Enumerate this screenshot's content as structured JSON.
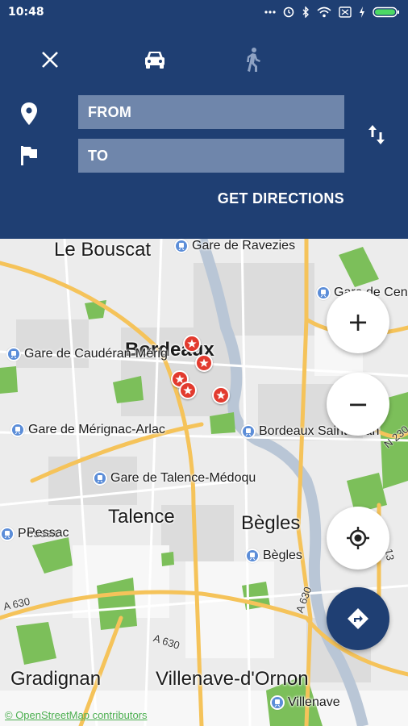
{
  "status_bar": {
    "time": "10:48",
    "icons": [
      "more-dots-icon",
      "alarm-icon",
      "bluetooth-icon",
      "wifi-icon",
      "sim-off-icon",
      "charging-icon",
      "battery-icon"
    ]
  },
  "header": {
    "modes": [
      "close-icon",
      "car-icon",
      "walk-icon"
    ],
    "from_label": "FROM",
    "to_label": "TO",
    "get_directions": "GET DIRECTIONS",
    "swap_icon": "swap-vertical-icon"
  },
  "map": {
    "places": {
      "le_bouscat": "Le Bouscat",
      "bordeaux": "Bordeaux",
      "talence": "Talence",
      "begles": "Bègles",
      "gradignan": "Gradignan",
      "villenave": "Villenave-d'Ornon",
      "pessac": "Pessac"
    },
    "stations": {
      "ravezies": "Gare de Ravezies",
      "cauderan": "Gare de Caudéran-Mérig",
      "merignac": "Gare de Mérignac-Arlac",
      "saint_jean": "Bordeaux Saint-Jean",
      "talence_medoquine": "Gare de Talence-Médoqu",
      "pessac": "Pessac",
      "begles": "Bègles",
      "villenave": "Villenave",
      "cenon": "Gare de Cenon"
    },
    "roads": [
      "A 630",
      "A 630",
      "A 630",
      "N 230",
      "13"
    ],
    "markers": 5,
    "attribution": "© OpenStreetMap contributors"
  },
  "controls": {
    "zoom_in": "+",
    "zoom_out": "−",
    "locate_icon": "my-location-icon",
    "directions_icon": "directions-icon"
  },
  "colors": {
    "header_bg": "#1f3f73",
    "field_bg": "#6f86ab",
    "marker": "#e23a2e",
    "road_major": "#f5c35a",
    "park": "#7cbf5a"
  }
}
